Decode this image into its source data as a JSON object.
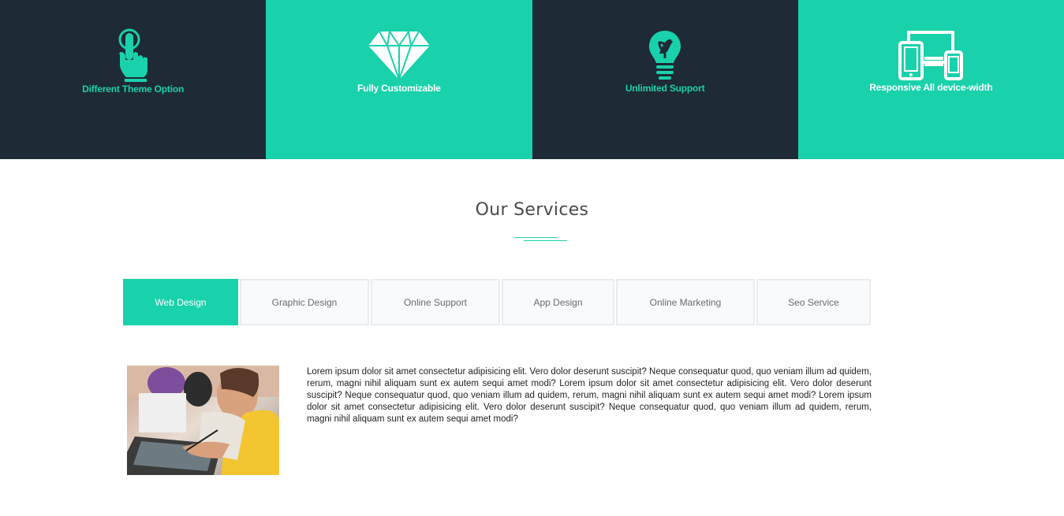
{
  "features": [
    {
      "label": "Different Theme Option",
      "icon": "pointing-hand-icon",
      "theme": "dark"
    },
    {
      "label": "Fully Customizable",
      "icon": "diamond-icon",
      "theme": "teal"
    },
    {
      "label": "Unlimited Support",
      "icon": "lightbulb-icon",
      "theme": "dark"
    },
    {
      "label": "Responsive All device-width",
      "icon": "responsive-devices-icon",
      "theme": "teal"
    }
  ],
  "services": {
    "title": "Our Services",
    "tabs": [
      {
        "label": "Web Design",
        "active": true
      },
      {
        "label": "Graphic Design",
        "active": false
      },
      {
        "label": "Online Support",
        "active": false
      },
      {
        "label": "App Design",
        "active": false
      },
      {
        "label": "Online Marketing",
        "active": false
      },
      {
        "label": "Seo Service",
        "active": false
      }
    ],
    "active_content": {
      "image": "designer-with-tablet-photo",
      "text": "Lorem ipsum dolor sit amet consectetur adipisicing elit. Vero dolor deserunt suscipit? Neque consequatur quod, quo veniam illum ad quidem, rerum, magni nihil aliquam sunt ex autem sequi amet modi? Lorem ipsum dolor sit amet consectetur adipisicing elit. Vero dolor deserunt suscipit? Neque consequatur quod, quo veniam illum ad quidem, rerum, magni nihil aliquam sunt ex autem sequi amet modi? Lorem ipsum dolor sit amet consectetur adipisicing elit. Vero dolor deserunt suscipit? Neque consequatur quod, quo veniam illum ad quidem, rerum, magni nihil aliquam sunt ex autem sequi amet modi?"
    }
  },
  "colors": {
    "accent": "#19d1ab",
    "dark": "#1e2a35",
    "tab_bg": "#f8fafc",
    "tab_border": "#e9ecef"
  }
}
